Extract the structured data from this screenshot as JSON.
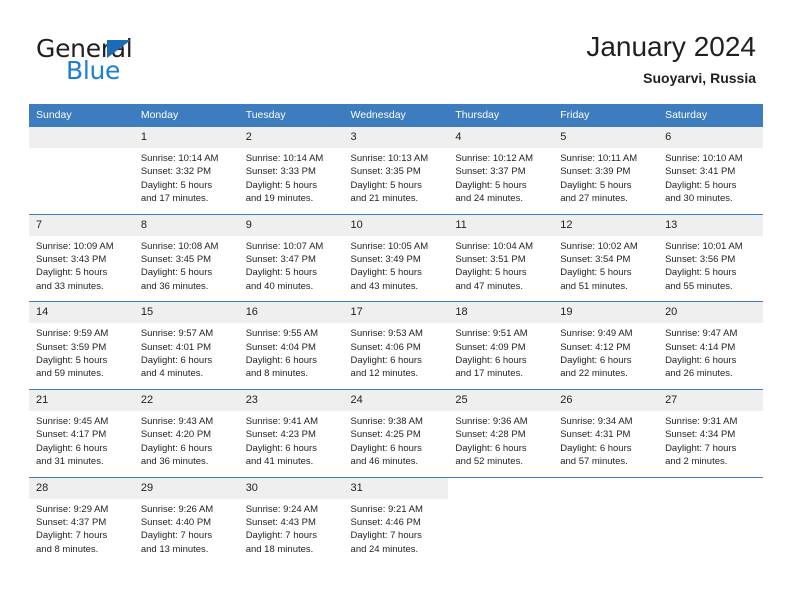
{
  "brand": {
    "name_dark": "General",
    "name_blue": "Blue",
    "accent_blue": "#1b7fd4",
    "triangle_blue": "#1b6cb5"
  },
  "header": {
    "title": "January 2024",
    "subtitle": "Suoyarvi, Russia",
    "header_bg": "#3d7cbf",
    "daynum_bg": "#efefef"
  },
  "weekday_headers": [
    "Sunday",
    "Monday",
    "Tuesday",
    "Wednesday",
    "Thursday",
    "Friday",
    "Saturday"
  ],
  "weeks": [
    [
      {
        "day": "",
        "blank": true,
        "sunrise": "",
        "sunset": "",
        "daylight1": "",
        "daylight2": ""
      },
      {
        "day": "1",
        "sunrise": "Sunrise: 10:14 AM",
        "sunset": "Sunset: 3:32 PM",
        "daylight1": "Daylight: 5 hours",
        "daylight2": "and 17 minutes."
      },
      {
        "day": "2",
        "sunrise": "Sunrise: 10:14 AM",
        "sunset": "Sunset: 3:33 PM",
        "daylight1": "Daylight: 5 hours",
        "daylight2": "and 19 minutes."
      },
      {
        "day": "3",
        "sunrise": "Sunrise: 10:13 AM",
        "sunset": "Sunset: 3:35 PM",
        "daylight1": "Daylight: 5 hours",
        "daylight2": "and 21 minutes."
      },
      {
        "day": "4",
        "sunrise": "Sunrise: 10:12 AM",
        "sunset": "Sunset: 3:37 PM",
        "daylight1": "Daylight: 5 hours",
        "daylight2": "and 24 minutes."
      },
      {
        "day": "5",
        "sunrise": "Sunrise: 10:11 AM",
        "sunset": "Sunset: 3:39 PM",
        "daylight1": "Daylight: 5 hours",
        "daylight2": "and 27 minutes."
      },
      {
        "day": "6",
        "sunrise": "Sunrise: 10:10 AM",
        "sunset": "Sunset: 3:41 PM",
        "daylight1": "Daylight: 5 hours",
        "daylight2": "and 30 minutes."
      }
    ],
    [
      {
        "day": "7",
        "sunrise": "Sunrise: 10:09 AM",
        "sunset": "Sunset: 3:43 PM",
        "daylight1": "Daylight: 5 hours",
        "daylight2": "and 33 minutes."
      },
      {
        "day": "8",
        "sunrise": "Sunrise: 10:08 AM",
        "sunset": "Sunset: 3:45 PM",
        "daylight1": "Daylight: 5 hours",
        "daylight2": "and 36 minutes."
      },
      {
        "day": "9",
        "sunrise": "Sunrise: 10:07 AM",
        "sunset": "Sunset: 3:47 PM",
        "daylight1": "Daylight: 5 hours",
        "daylight2": "and 40 minutes."
      },
      {
        "day": "10",
        "sunrise": "Sunrise: 10:05 AM",
        "sunset": "Sunset: 3:49 PM",
        "daylight1": "Daylight: 5 hours",
        "daylight2": "and 43 minutes."
      },
      {
        "day": "11",
        "sunrise": "Sunrise: 10:04 AM",
        "sunset": "Sunset: 3:51 PM",
        "daylight1": "Daylight: 5 hours",
        "daylight2": "and 47 minutes."
      },
      {
        "day": "12",
        "sunrise": "Sunrise: 10:02 AM",
        "sunset": "Sunset: 3:54 PM",
        "daylight1": "Daylight: 5 hours",
        "daylight2": "and 51 minutes."
      },
      {
        "day": "13",
        "sunrise": "Sunrise: 10:01 AM",
        "sunset": "Sunset: 3:56 PM",
        "daylight1": "Daylight: 5 hours",
        "daylight2": "and 55 minutes."
      }
    ],
    [
      {
        "day": "14",
        "sunrise": "Sunrise: 9:59 AM",
        "sunset": "Sunset: 3:59 PM",
        "daylight1": "Daylight: 5 hours",
        "daylight2": "and 59 minutes."
      },
      {
        "day": "15",
        "sunrise": "Sunrise: 9:57 AM",
        "sunset": "Sunset: 4:01 PM",
        "daylight1": "Daylight: 6 hours",
        "daylight2": "and 4 minutes."
      },
      {
        "day": "16",
        "sunrise": "Sunrise: 9:55 AM",
        "sunset": "Sunset: 4:04 PM",
        "daylight1": "Daylight: 6 hours",
        "daylight2": "and 8 minutes."
      },
      {
        "day": "17",
        "sunrise": "Sunrise: 9:53 AM",
        "sunset": "Sunset: 4:06 PM",
        "daylight1": "Daylight: 6 hours",
        "daylight2": "and 12 minutes."
      },
      {
        "day": "18",
        "sunrise": "Sunrise: 9:51 AM",
        "sunset": "Sunset: 4:09 PM",
        "daylight1": "Daylight: 6 hours",
        "daylight2": "and 17 minutes."
      },
      {
        "day": "19",
        "sunrise": "Sunrise: 9:49 AM",
        "sunset": "Sunset: 4:12 PM",
        "daylight1": "Daylight: 6 hours",
        "daylight2": "and 22 minutes."
      },
      {
        "day": "20",
        "sunrise": "Sunrise: 9:47 AM",
        "sunset": "Sunset: 4:14 PM",
        "daylight1": "Daylight: 6 hours",
        "daylight2": "and 26 minutes."
      }
    ],
    [
      {
        "day": "21",
        "sunrise": "Sunrise: 9:45 AM",
        "sunset": "Sunset: 4:17 PM",
        "daylight1": "Daylight: 6 hours",
        "daylight2": "and 31 minutes."
      },
      {
        "day": "22",
        "sunrise": "Sunrise: 9:43 AM",
        "sunset": "Sunset: 4:20 PM",
        "daylight1": "Daylight: 6 hours",
        "daylight2": "and 36 minutes."
      },
      {
        "day": "23",
        "sunrise": "Sunrise: 9:41 AM",
        "sunset": "Sunset: 4:23 PM",
        "daylight1": "Daylight: 6 hours",
        "daylight2": "and 41 minutes."
      },
      {
        "day": "24",
        "sunrise": "Sunrise: 9:38 AM",
        "sunset": "Sunset: 4:25 PM",
        "daylight1": "Daylight: 6 hours",
        "daylight2": "and 46 minutes."
      },
      {
        "day": "25",
        "sunrise": "Sunrise: 9:36 AM",
        "sunset": "Sunset: 4:28 PM",
        "daylight1": "Daylight: 6 hours",
        "daylight2": "and 52 minutes."
      },
      {
        "day": "26",
        "sunrise": "Sunrise: 9:34 AM",
        "sunset": "Sunset: 4:31 PM",
        "daylight1": "Daylight: 6 hours",
        "daylight2": "and 57 minutes."
      },
      {
        "day": "27",
        "sunrise": "Sunrise: 9:31 AM",
        "sunset": "Sunset: 4:34 PM",
        "daylight1": "Daylight: 7 hours",
        "daylight2": "and 2 minutes."
      }
    ],
    [
      {
        "day": "28",
        "sunrise": "Sunrise: 9:29 AM",
        "sunset": "Sunset: 4:37 PM",
        "daylight1": "Daylight: 7 hours",
        "daylight2": "and 8 minutes."
      },
      {
        "day": "29",
        "sunrise": "Sunrise: 9:26 AM",
        "sunset": "Sunset: 4:40 PM",
        "daylight1": "Daylight: 7 hours",
        "daylight2": "and 13 minutes."
      },
      {
        "day": "30",
        "sunrise": "Sunrise: 9:24 AM",
        "sunset": "Sunset: 4:43 PM",
        "daylight1": "Daylight: 7 hours",
        "daylight2": "and 18 minutes."
      },
      {
        "day": "31",
        "sunrise": "Sunrise: 9:21 AM",
        "sunset": "Sunset: 4:46 PM",
        "daylight1": "Daylight: 7 hours",
        "daylight2": "and 24 minutes."
      },
      {
        "day": "",
        "void": true,
        "sunrise": "",
        "sunset": "",
        "daylight1": "",
        "daylight2": ""
      },
      {
        "day": "",
        "void": true,
        "sunrise": "",
        "sunset": "",
        "daylight1": "",
        "daylight2": ""
      },
      {
        "day": "",
        "void": true,
        "sunrise": "",
        "sunset": "",
        "daylight1": "",
        "daylight2": ""
      }
    ]
  ]
}
